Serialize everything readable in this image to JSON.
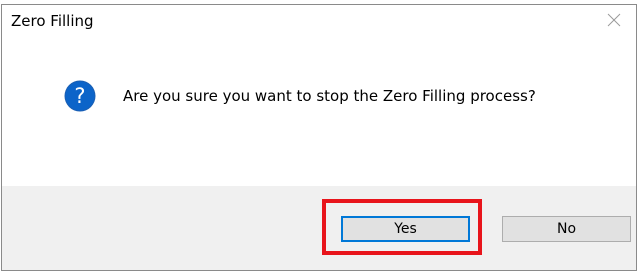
{
  "dialog": {
    "title": "Zero Filling",
    "message": "Are you sure you want to stop the Zero Filling process?",
    "icon": "question-icon",
    "close_icon": "close-icon"
  },
  "buttons": {
    "yes_label": "Yes",
    "no_label": "No"
  },
  "colors": {
    "accent": "#0078d7",
    "highlight": "#e8141b",
    "footer_bg": "#f0f0f0",
    "button_bg": "#e1e1e1"
  }
}
